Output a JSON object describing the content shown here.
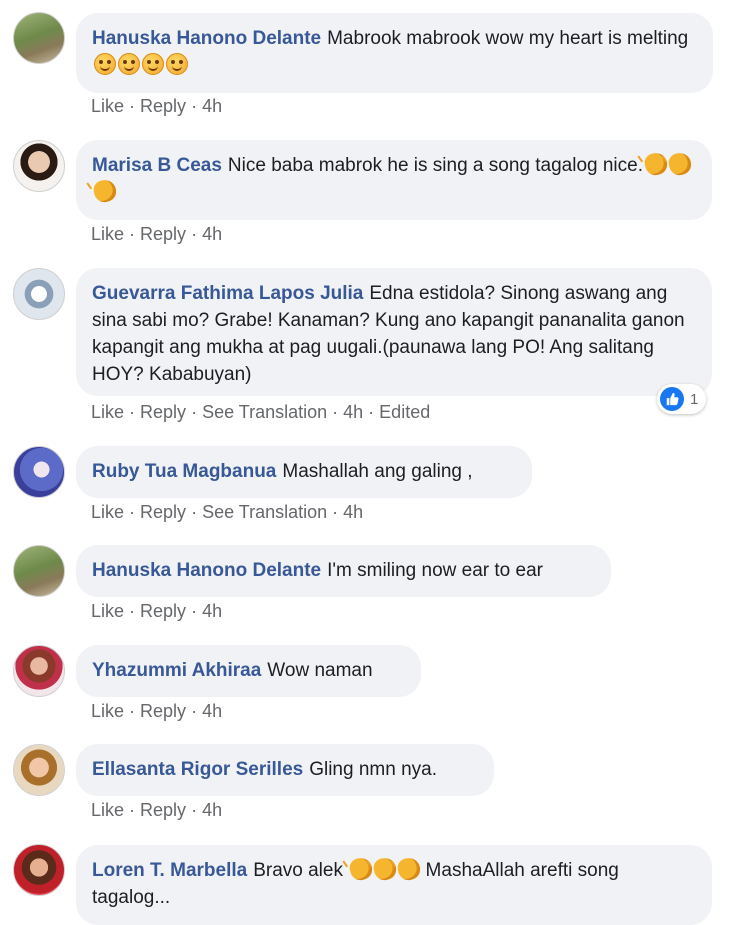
{
  "comments": [
    {
      "author": "Hanuska Hanono Delante",
      "text": "Mabrook mabrook wow my heart is melting",
      "emoji": "smile",
      "emoji_count": 4,
      "actions": [
        "Like",
        "Reply"
      ],
      "time": "4h"
    },
    {
      "author": "Marisa B Ceas",
      "text": "Nice baba mabrok he is sing a song tagalog nice.",
      "emoji": "clap",
      "emoji_count": 3,
      "actions": [
        "Like",
        "Reply"
      ],
      "time": "4h"
    },
    {
      "author": "Guevarra Fathima Lapos Julia",
      "text": "Edna estidola? Sinong aswang ang sina sabi mo? Grabe! Kanaman? Kung ano kapangit pananalita ganon kapangit ang mukha at pag uugali.(paunawa lang PO! Ang salitang HOY? Kababuyan)",
      "actions": [
        "Like",
        "Reply",
        "See Translation"
      ],
      "time": "4h",
      "edited": "Edited",
      "reaction_count": "1"
    },
    {
      "author": "Ruby Tua Magbanua",
      "text": "Mashallah ang galing ,",
      "actions": [
        "Like",
        "Reply",
        "See Translation"
      ],
      "time": "4h"
    },
    {
      "author": "Hanuska Hanono Delante",
      "text": "I'm smiling now ear to ear",
      "actions": [
        "Like",
        "Reply"
      ],
      "time": "4h"
    },
    {
      "author": "Yhazummi Akhiraa",
      "text": "Wow naman",
      "actions": [
        "Like",
        "Reply"
      ],
      "time": "4h"
    },
    {
      "author": "Ellasanta Rigor Serilles",
      "text": "Gling nmn nya.",
      "actions": [
        "Like",
        "Reply"
      ],
      "time": "4h"
    },
    {
      "author": "Loren T. Marbella",
      "text_before": "Bravo alek",
      "emoji": "clap",
      "emoji_count": 3,
      "text_after": "MashaAllah arefti song tagalog...",
      "actions": [],
      "time": ""
    }
  ],
  "colors": {
    "author": "#385898",
    "bubble": "#f0f2f5",
    "meta": "#65676b",
    "like": "#1877f2"
  }
}
